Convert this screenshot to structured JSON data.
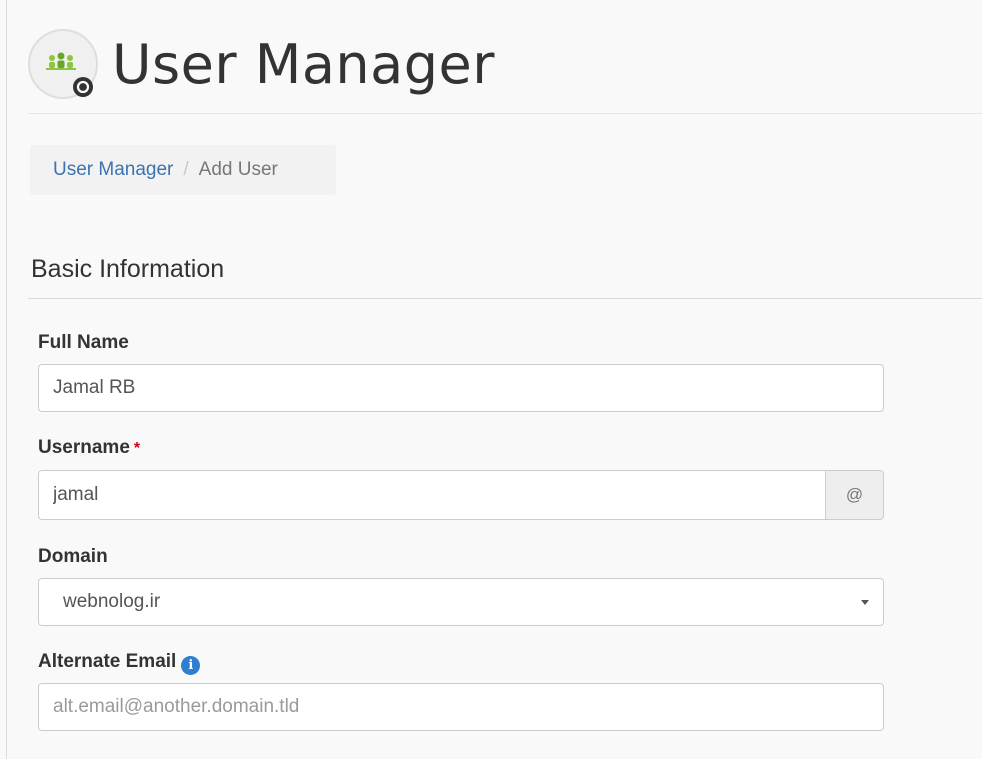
{
  "header": {
    "title": "User Manager",
    "icon": "user-manager-icon"
  },
  "breadcrumb": {
    "parent": "User Manager",
    "separator": "/",
    "current": "Add User"
  },
  "section": {
    "title": "Basic Information"
  },
  "form": {
    "full_name": {
      "label": "Full Name",
      "value": "Jamal RB"
    },
    "username": {
      "label": "Username",
      "required_mark": "*",
      "value": "jamal",
      "addon": "@"
    },
    "domain": {
      "label": "Domain",
      "selected": "webnolog.ir"
    },
    "alternate_email": {
      "label": "Alternate Email",
      "info_icon": "i",
      "placeholder": "alt.email@another.domain.tld",
      "value": ""
    }
  },
  "colors": {
    "link": "#3b73b0",
    "required": "#d0021b",
    "info": "#2f7fd0"
  }
}
